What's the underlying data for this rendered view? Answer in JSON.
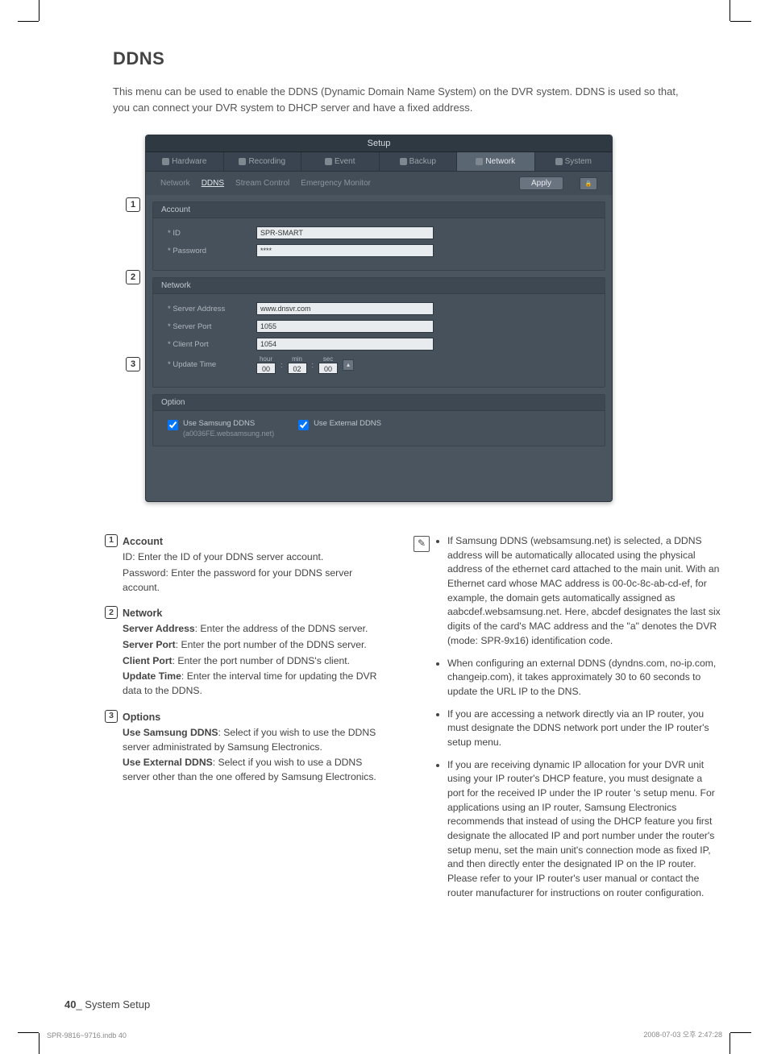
{
  "page": {
    "title": "DDNS",
    "intro": "This menu can be used to enable the DDNS (Dynamic Domain Name System) on the DVR system. DDNS is used so that, you can connect your DVR system to DHCP server and have a fixed address."
  },
  "setup": {
    "window_title": "Setup",
    "tabs": [
      "Hardware",
      "Recording",
      "Event",
      "Backup",
      "Network",
      "System"
    ],
    "active_tab": "Network",
    "subtabs": [
      "Network",
      "DDNS",
      "Stream Control",
      "Emergency Monitor"
    ],
    "active_subtab": "DDNS",
    "apply_label": "Apply",
    "groups": {
      "account": {
        "title": "Account",
        "id_label": "ID",
        "id_value": "SPR-SMART",
        "pw_label": "Password",
        "pw_value": "****"
      },
      "network": {
        "title": "Network",
        "server_addr_label": "Server Address",
        "server_addr_value": "www.dnsvr.com",
        "server_port_label": "Server Port",
        "server_port_value": "1055",
        "client_port_label": "Client Port",
        "client_port_value": "1054",
        "update_time_label": "Update Time",
        "time_hour_label": "hour",
        "time_hour": "00",
        "time_min_label": "min",
        "time_min": "02",
        "time_sec_label": "sec",
        "time_sec": "00"
      },
      "option": {
        "title": "Option",
        "samsung_label": "Use Samsung DDNS",
        "samsung_sub": "(a0036FE.websamsung.net)",
        "external_label": "Use External DDNS"
      }
    }
  },
  "callouts": {
    "1": "1",
    "2": "2",
    "3": "3"
  },
  "defs": {
    "account": {
      "num": "1",
      "title": "Account",
      "l1": "ID: Enter the ID of your DDNS server account.",
      "l2": "Password: Enter the password for your DDNS server account."
    },
    "network": {
      "num": "2",
      "title": "Network",
      "sa_b": "Server Address",
      "sa_t": ": Enter the address of  the DDNS server.",
      "sp_b": "Server Port",
      "sp_t": ": Enter the port number of the DDNS server.",
      "cp_b": "Client Port",
      "cp_t": ": Enter the port number of DDNS's client.",
      "ut_b": "Update Time",
      "ut_t": ": Enter the interval time for updating the DVR data to the DDNS."
    },
    "options": {
      "num": "3",
      "title": "Options",
      "us_b": "Use Samsung DDNS",
      "us_t": ": Select if you wish to use the DDNS server administrated by Samsung Electronics.",
      "ue_b": "Use External DDNS",
      "ue_t": ": Select if you wish to use a DDNS server other than the one offered by Samsung Electronics."
    }
  },
  "notes": {
    "n1": "If Samsung DDNS (websamsung.net) is selected, a DDNS address will be automatically allocated using the physical address of the ethernet card attached to the main unit. With an Ethernet card whose MAC address is 00-0c-8c-ab-cd-ef, for example, the domain gets automatically assigned as aabcdef.websamsung.net. Here, abcdef designates the last six digits of the card's MAC address and the \"a\" denotes the DVR (mode: SPR-9x16) identification code.",
    "n2": "When configuring an external DDNS (dyndns.com, no-ip.com, changeip.com), it takes approximately 30 to 60 seconds to update the URL IP to the DNS.",
    "n3": "If you are accessing a network directly via an IP router, you must designate the DDNS network port under the IP router's setup menu.",
    "n4": "If you are receiving dynamic IP allocation for your DVR unit using your IP router's DHCP feature, you must designate a port for the received IP under the IP router 's setup menu. For applications using an IP router, Samsung Electronics recommends that instead of using the DHCP feature you first designate the allocated IP and port number under the router's setup menu, set the main unit's connection mode as fixed IP, and then directly enter the designated IP on the IP router. Please refer to your IP router's user manual or contact the router manufacturer for instructions on router configuration."
  },
  "footer": {
    "page_num": "40",
    "label": "_ System Setup"
  },
  "meta": {
    "left": "SPR-9816~9716.indb   40",
    "right": "2008-07-03   오후 2:47:28"
  }
}
